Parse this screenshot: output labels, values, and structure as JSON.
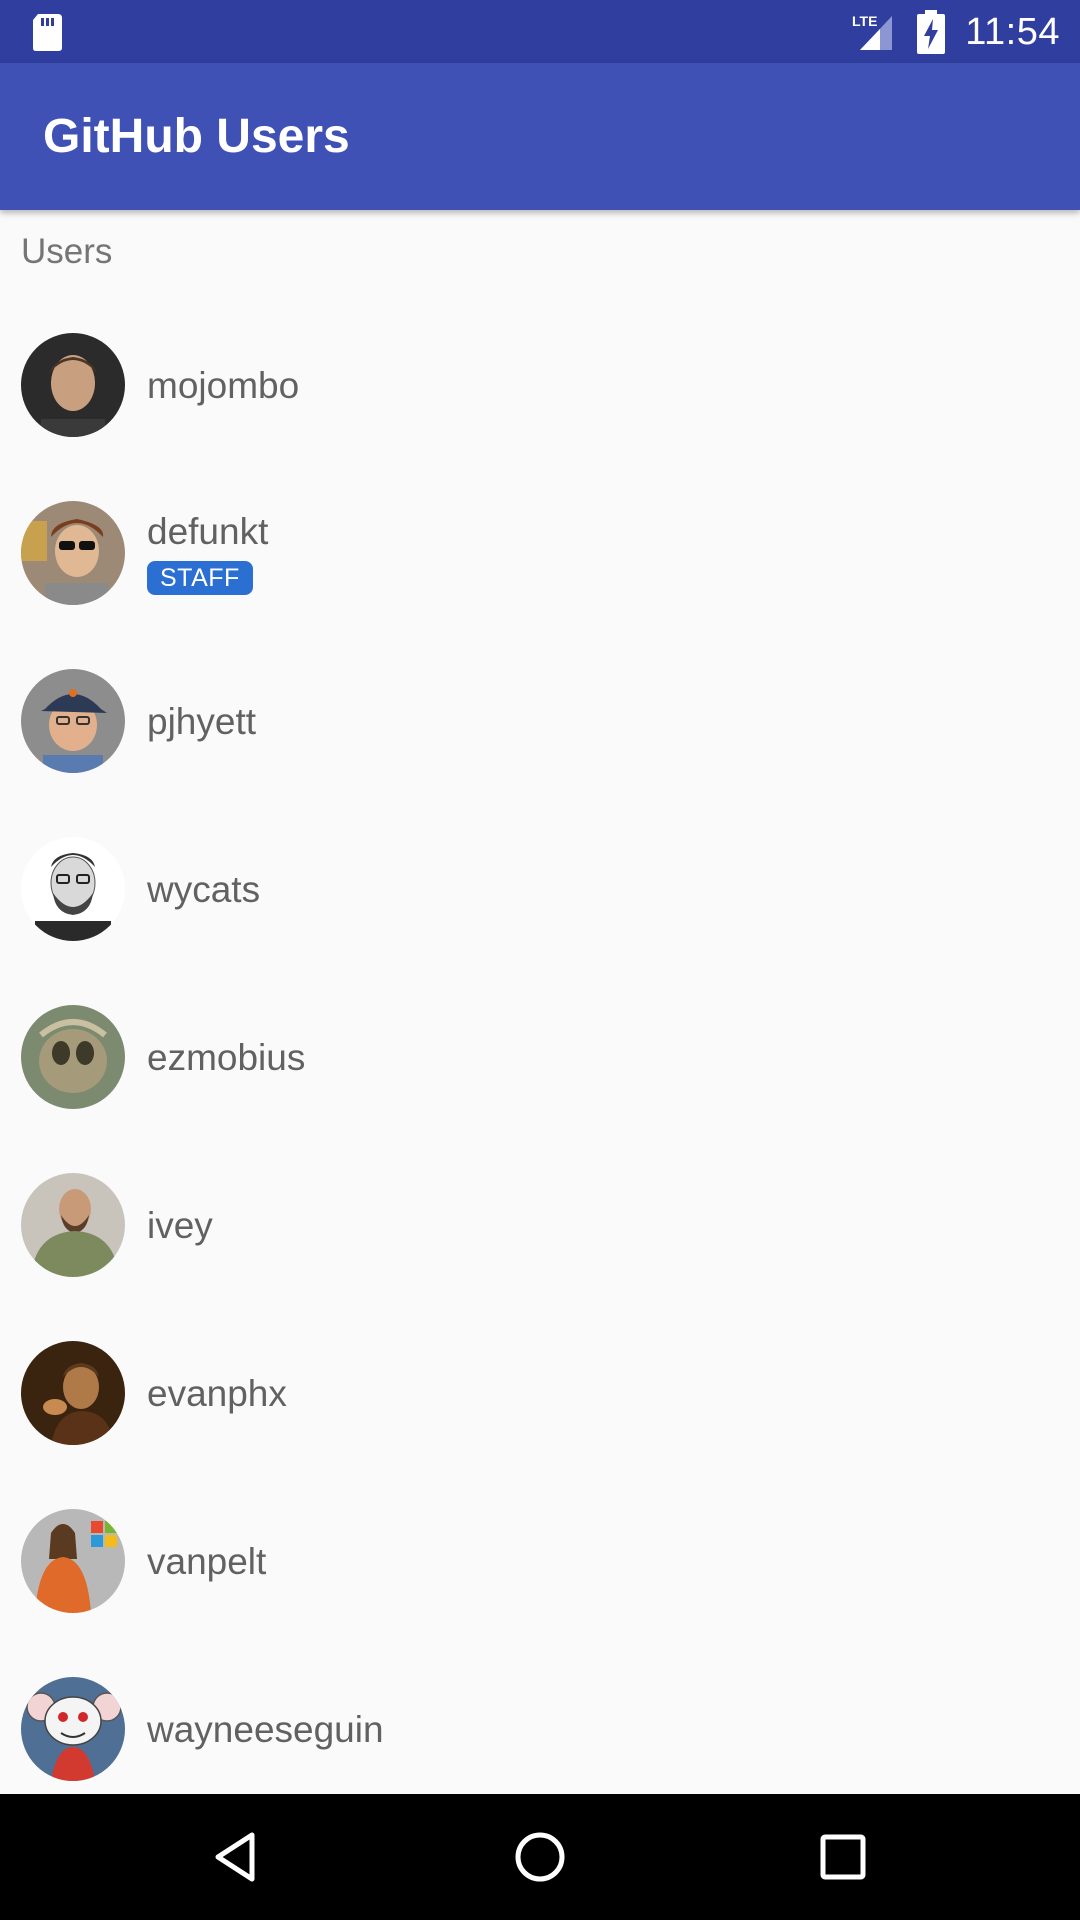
{
  "status_bar": {
    "time": "11:54",
    "network_label": "LTE",
    "icons": [
      "sd-card-icon",
      "lte-signal-icon",
      "battery-charging-icon"
    ]
  },
  "app_bar": {
    "title": "GitHub Users",
    "color": "#3f51b5",
    "status_color": "#303f9f"
  },
  "section_header": "Users",
  "users": [
    {
      "login": "mojombo"
    },
    {
      "login": "defunkt",
      "badge": "STAFF"
    },
    {
      "login": "pjhyett"
    },
    {
      "login": "wycats"
    },
    {
      "login": "ezmobius"
    },
    {
      "login": "ivey"
    },
    {
      "login": "evanphx"
    },
    {
      "login": "vanpelt"
    },
    {
      "login": "wayneeseguin"
    }
  ],
  "badge_color": "#2a6fd1",
  "nav_bar": {
    "icons": [
      "back-icon",
      "home-icon",
      "recents-icon"
    ]
  }
}
